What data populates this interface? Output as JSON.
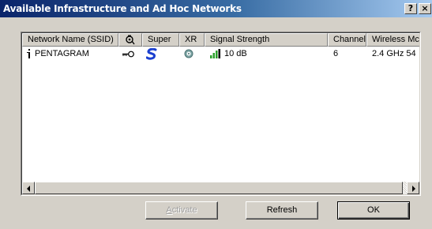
{
  "window": {
    "title": "Available Infrastructure and Ad Hoc Networks",
    "help_label": "?",
    "close_label": "×"
  },
  "list": {
    "columns": [
      {
        "label": "Network Name (SSID)"
      },
      {
        "label": "",
        "icon": "key-lock-icon"
      },
      {
        "label": "Super"
      },
      {
        "label": "XR"
      },
      {
        "label": "Signal Strength"
      },
      {
        "label": "Channel"
      },
      {
        "label": "Wireless Mc"
      }
    ],
    "rows": [
      {
        "name": "PENTAGRAM",
        "network_icon": "access-point-icon",
        "security_icon": "key-icon",
        "super_icon": "super-s-icon",
        "xr_icon": "xr-disc-icon",
        "signal_icon": "signal-bars-icon",
        "signal": "10 dB",
        "channel": "6",
        "wireless_mode": "2.4 GHz 54"
      }
    ]
  },
  "buttons": {
    "activate": "Activate",
    "activate_accel": "A",
    "activate_rest": "ctivate",
    "refresh": "Refresh",
    "ok": "OK"
  },
  "colors": {
    "title_bar_start": "#0a246a",
    "title_bar_end": "#a6caf0",
    "face": "#d4d0c8",
    "signal_green": "#2aa02a",
    "super_blue": "#1a3fd0"
  }
}
